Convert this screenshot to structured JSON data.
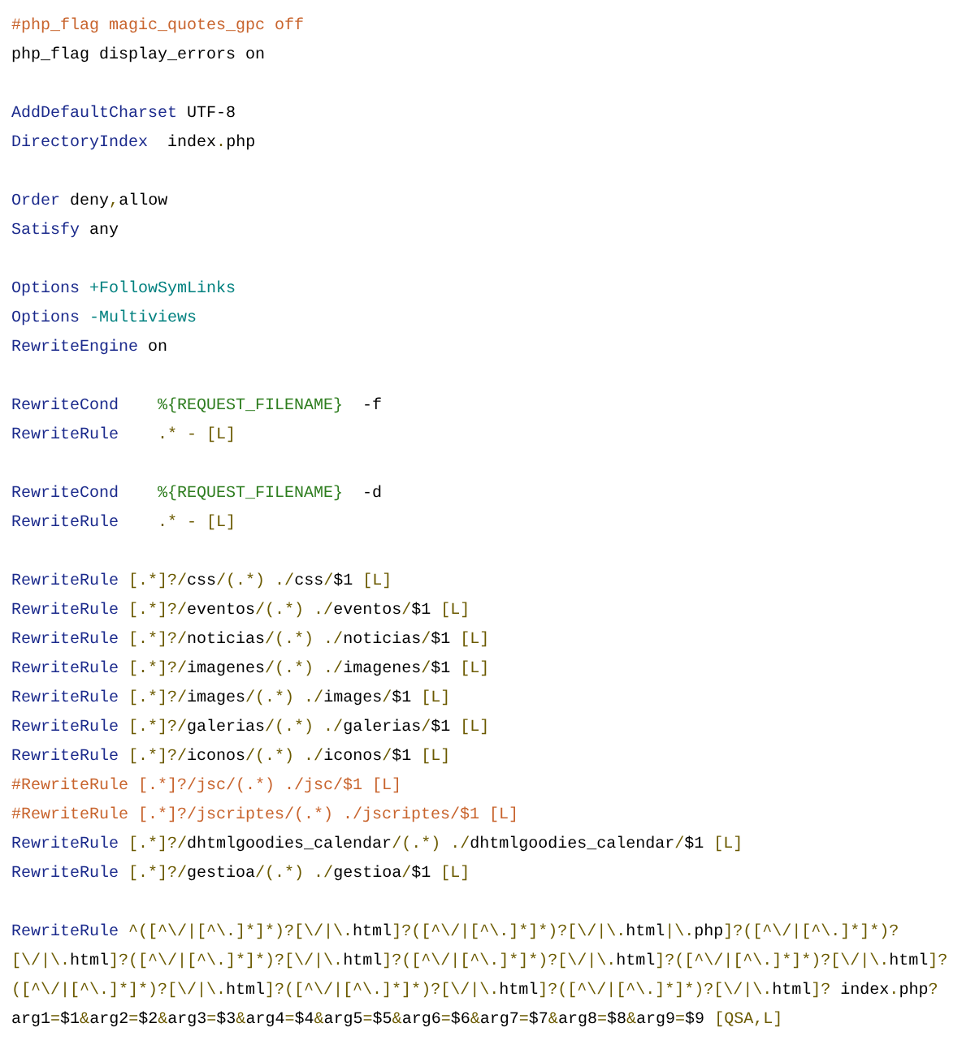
{
  "code_lines": [
    {
      "tokens": [
        {
          "text": "#php_flag magic_quotes_gpc off",
          "kind": "comment"
        }
      ]
    },
    {
      "tokens": [
        {
          "text": "php_flag display_errors on",
          "kind": "plain"
        }
      ]
    },
    {
      "kind": "blank"
    },
    {
      "tokens": [
        {
          "text": "AddDefaultCharset",
          "kind": "keyword"
        },
        {
          "text": " UTF-8",
          "kind": "plain"
        }
      ]
    },
    {
      "tokens": [
        {
          "text": "DirectoryIndex",
          "kind": "keyword"
        },
        {
          "text": "  index.php",
          "kind": "pattern"
        }
      ]
    },
    {
      "kind": "blank"
    },
    {
      "tokens": [
        {
          "text": "Order",
          "kind": "keyword"
        },
        {
          "text": " deny,allow",
          "kind": "pattern"
        }
      ]
    },
    {
      "tokens": [
        {
          "text": "Satisfy",
          "kind": "keyword"
        },
        {
          "text": " any",
          "kind": "plain"
        }
      ]
    },
    {
      "kind": "blank"
    },
    {
      "tokens": [
        {
          "text": "Options",
          "kind": "keyword"
        },
        {
          "text": " +FollowSymLinks",
          "kind": "option"
        }
      ]
    },
    {
      "tokens": [
        {
          "text": "Options",
          "kind": "keyword"
        },
        {
          "text": " -Multiviews",
          "kind": "option"
        }
      ]
    },
    {
      "tokens": [
        {
          "text": "RewriteEngine",
          "kind": "keyword"
        },
        {
          "text": " on",
          "kind": "plain"
        }
      ]
    },
    {
      "kind": "blank"
    },
    {
      "tokens": [
        {
          "text": "RewriteCond",
          "kind": "keyword"
        },
        {
          "text": "    %{REQUEST_FILENAME}",
          "kind": "variable"
        },
        {
          "text": "  -f",
          "kind": "plain"
        }
      ]
    },
    {
      "tokens": [
        {
          "text": "RewriteRule",
          "kind": "keyword"
        },
        {
          "text": "    .* - [L]",
          "kind": "punct"
        }
      ]
    },
    {
      "kind": "blank"
    },
    {
      "tokens": [
        {
          "text": "RewriteCond",
          "kind": "keyword"
        },
        {
          "text": "    %{REQUEST_FILENAME}",
          "kind": "variable"
        },
        {
          "text": "  -d",
          "kind": "plain"
        }
      ]
    },
    {
      "tokens": [
        {
          "text": "RewriteRule",
          "kind": "keyword"
        },
        {
          "text": "    .* - [L]",
          "kind": "punct"
        }
      ]
    },
    {
      "kind": "blank"
    },
    {
      "tokens": [
        {
          "text": "RewriteRule",
          "kind": "keyword"
        },
        {
          "text": " [.*]?/css/(.*) ./css/$1 ",
          "kind": "pattern"
        },
        {
          "text": "[L]",
          "kind": "punct"
        }
      ]
    },
    {
      "tokens": [
        {
          "text": "RewriteRule",
          "kind": "keyword"
        },
        {
          "text": " [.*]?/eventos/(.*) ./eventos/$1 ",
          "kind": "pattern"
        },
        {
          "text": "[L]",
          "kind": "punct"
        }
      ]
    },
    {
      "tokens": [
        {
          "text": "RewriteRule",
          "kind": "keyword"
        },
        {
          "text": " [.*]?/noticias/(.*) ./noticias/$1 ",
          "kind": "pattern"
        },
        {
          "text": "[L]",
          "kind": "punct"
        }
      ]
    },
    {
      "tokens": [
        {
          "text": "RewriteRule",
          "kind": "keyword"
        },
        {
          "text": " [.*]?/imagenes/(.*) ./imagenes/$1 ",
          "kind": "pattern"
        },
        {
          "text": "[L]",
          "kind": "punct"
        }
      ]
    },
    {
      "tokens": [
        {
          "text": "RewriteRule",
          "kind": "keyword"
        },
        {
          "text": " [.*]?/images/(.*) ./images/$1 ",
          "kind": "pattern"
        },
        {
          "text": "[L]",
          "kind": "punct"
        }
      ]
    },
    {
      "tokens": [
        {
          "text": "RewriteRule",
          "kind": "keyword"
        },
        {
          "text": " [.*]?/galerias/(.*) ./galerias/$1 ",
          "kind": "pattern"
        },
        {
          "text": "[L]",
          "kind": "punct"
        }
      ]
    },
    {
      "tokens": [
        {
          "text": "RewriteRule",
          "kind": "keyword"
        },
        {
          "text": " [.*]?/iconos/(.*) ./iconos/$1 ",
          "kind": "pattern"
        },
        {
          "text": "[L]",
          "kind": "punct"
        }
      ]
    },
    {
      "tokens": [
        {
          "text": "#RewriteRule [.*]?/jsc/(.*) ./jsc/$1 [L]",
          "kind": "comment"
        }
      ]
    },
    {
      "tokens": [
        {
          "text": "#RewriteRule [.*]?/jscriptes/(.*) ./jscriptes/$1 [L]",
          "kind": "comment"
        }
      ]
    },
    {
      "tokens": [
        {
          "text": "RewriteRule",
          "kind": "keyword"
        },
        {
          "text": " [.*]?/dhtmlgoodies_calendar/(.*) ./dhtmlgoodies_calendar/$1 ",
          "kind": "pattern"
        },
        {
          "text": "[L]",
          "kind": "punct"
        }
      ]
    },
    {
      "tokens": [
        {
          "text": "RewriteRule",
          "kind": "keyword"
        },
        {
          "text": " [.*]?/gestioa/(.*) ./gestioa/$1 ",
          "kind": "pattern"
        },
        {
          "text": "[L]",
          "kind": "punct"
        }
      ]
    },
    {
      "kind": "blank"
    },
    {
      "tokens": [
        {
          "text": "RewriteRule",
          "kind": "keyword"
        },
        {
          "text": " ^([^\\/|[^\\.]*]*)?[\\/|\\.html]?([^\\/|[^\\.]*]*)?[\\/|\\.html|\\.php]?([^\\/|[^\\.]*]*)?",
          "kind": "pattern"
        }
      ]
    },
    {
      "tokens": [
        {
          "text": "[\\/|\\.html]?([^\\/|[^\\.]*]*)?[\\/|\\.html]?([^\\/|[^\\.]*]*)?[\\/|\\.html]?([^\\/|[^\\.]*]*)?[\\/|\\.html]?",
          "kind": "pattern"
        }
      ]
    },
    {
      "tokens": [
        {
          "text": "([^\\/|[^\\.]*]*)?[\\/|\\.html]?([^\\/|[^\\.]*]*)?[\\/|\\.html]?([^\\/|[^\\.]*]*)?[\\/|\\.html]? index.php?",
          "kind": "pattern"
        }
      ]
    },
    {
      "tokens": [
        {
          "text": "arg1=$1&arg2=$2&arg3=$3&arg4=$4&arg5=$5&arg6=$6&arg7=$7&arg8=$8&arg9=$9 ",
          "kind": "pattern"
        },
        {
          "text": "[QSA,L]",
          "kind": "punct"
        }
      ]
    }
  ]
}
